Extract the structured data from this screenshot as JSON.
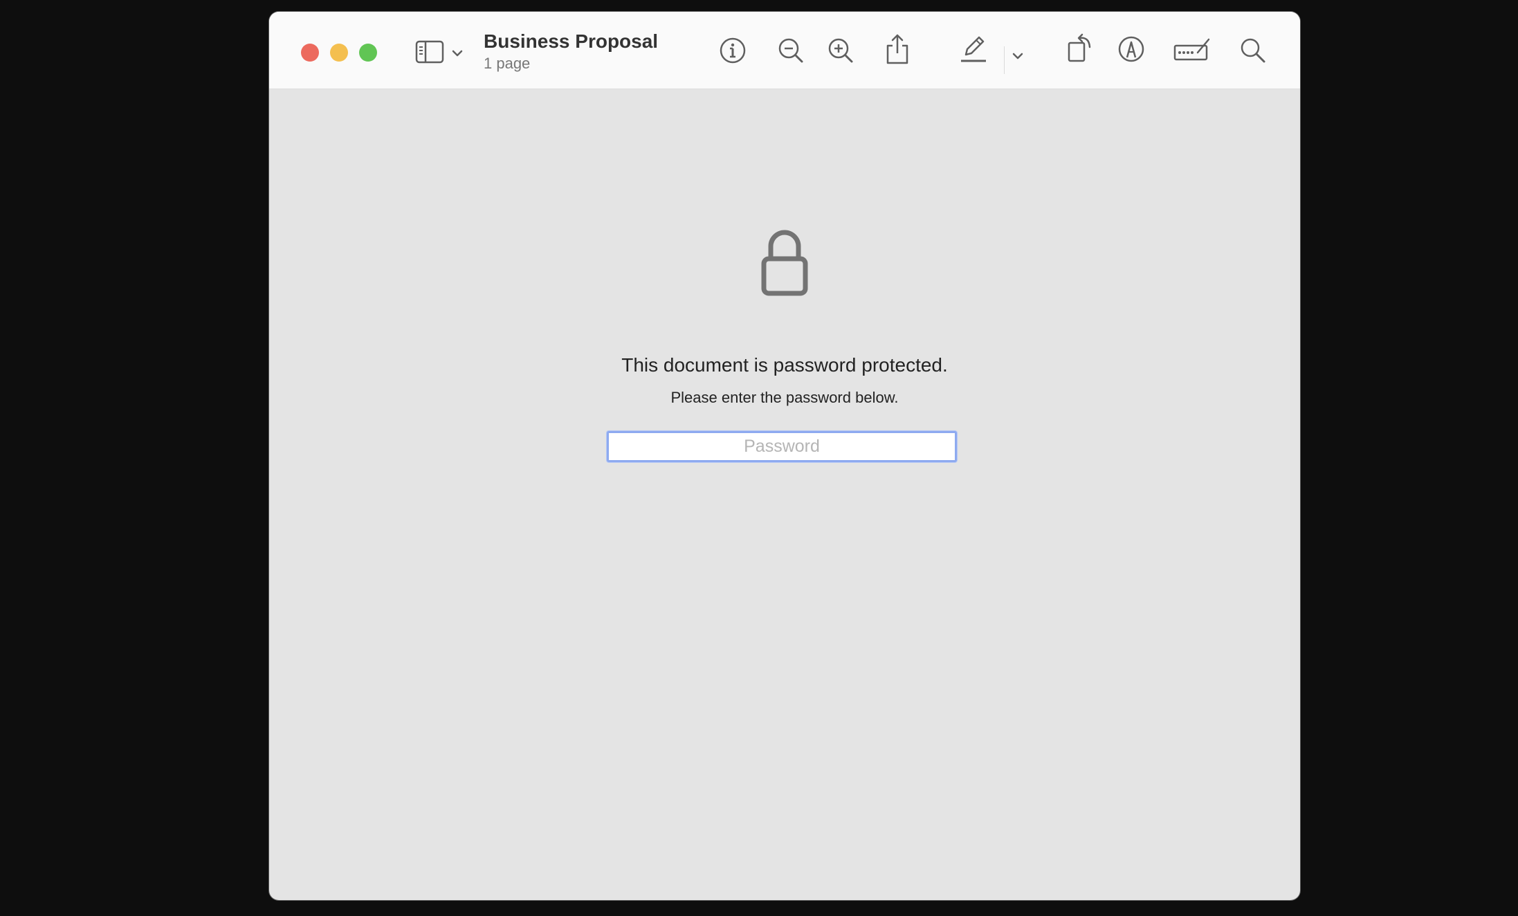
{
  "window": {
    "title": "Business Proposal",
    "subtitle": "1 page"
  },
  "toolbar": {
    "icons": [
      "sidebar-icon",
      "chevron-down-icon",
      "info-icon",
      "zoom-out-icon",
      "zoom-in-icon",
      "share-icon",
      "highlight-pen-icon",
      "chevron-down-icon",
      "rotate-icon",
      "markup-icon",
      "form-fill-icon",
      "search-icon"
    ]
  },
  "lock_screen": {
    "icon": "lock-icon",
    "title": "This document is password protected.",
    "subtitle": "Please enter the password below.",
    "password_placeholder": "Password",
    "password_value": ""
  },
  "colors": {
    "close": "#ec6a5e",
    "minimize": "#f4bf4f",
    "maximize": "#61c554",
    "focus_ring": "#8eaaf0",
    "content_bg": "#e4e4e4"
  }
}
